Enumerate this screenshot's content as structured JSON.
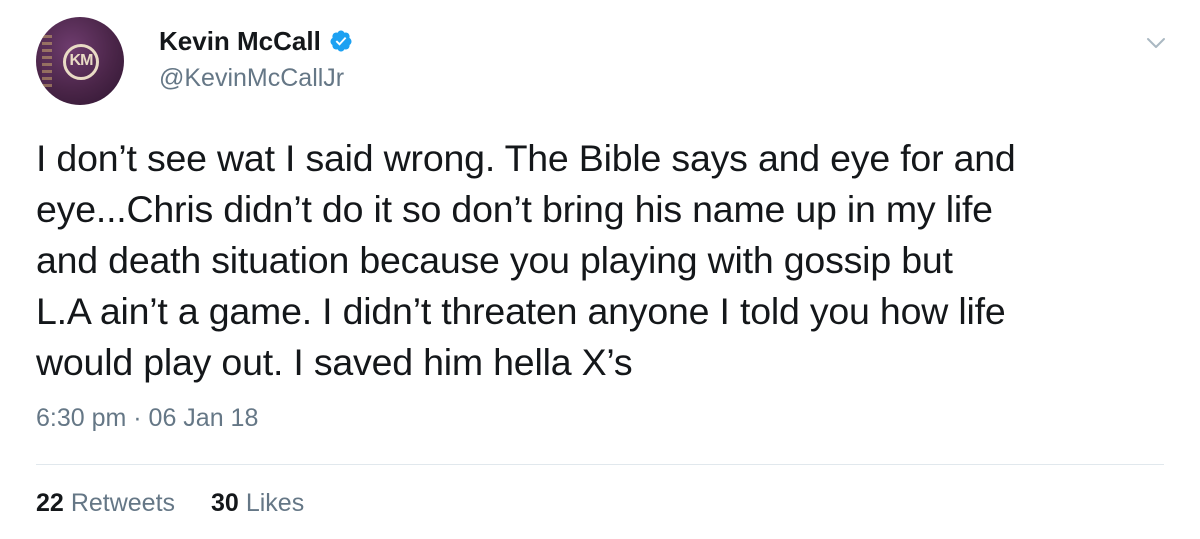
{
  "author": {
    "display_name": "Kevin McCall",
    "handle": "@KevinMcCallJr",
    "verified": true,
    "avatar_monogram": "KM"
  },
  "tweet": {
    "text": "I don’t see wat I said wrong. The Bible says and eye for and\neye...Chris didn’t do it so don’t bring his name up in my life\nand death situation because you playing with gossip but\nL.A ain’t a game. I didn’t threaten anyone I told you how life\nwould play out. I saved him hella X’s",
    "timestamp": "6:30 pm · 06 Jan 18"
  },
  "stats": {
    "retweets_count": "22",
    "retweets_label": "Retweets",
    "likes_count": "30",
    "likes_label": "Likes"
  },
  "icons": {
    "verified": "verified-badge-icon",
    "menu": "chevron-down-icon"
  },
  "colors": {
    "verified_blue": "#1da1f2",
    "secondary_text": "#657786",
    "primary_text": "#14171a",
    "divider": "#e1e8ed"
  }
}
